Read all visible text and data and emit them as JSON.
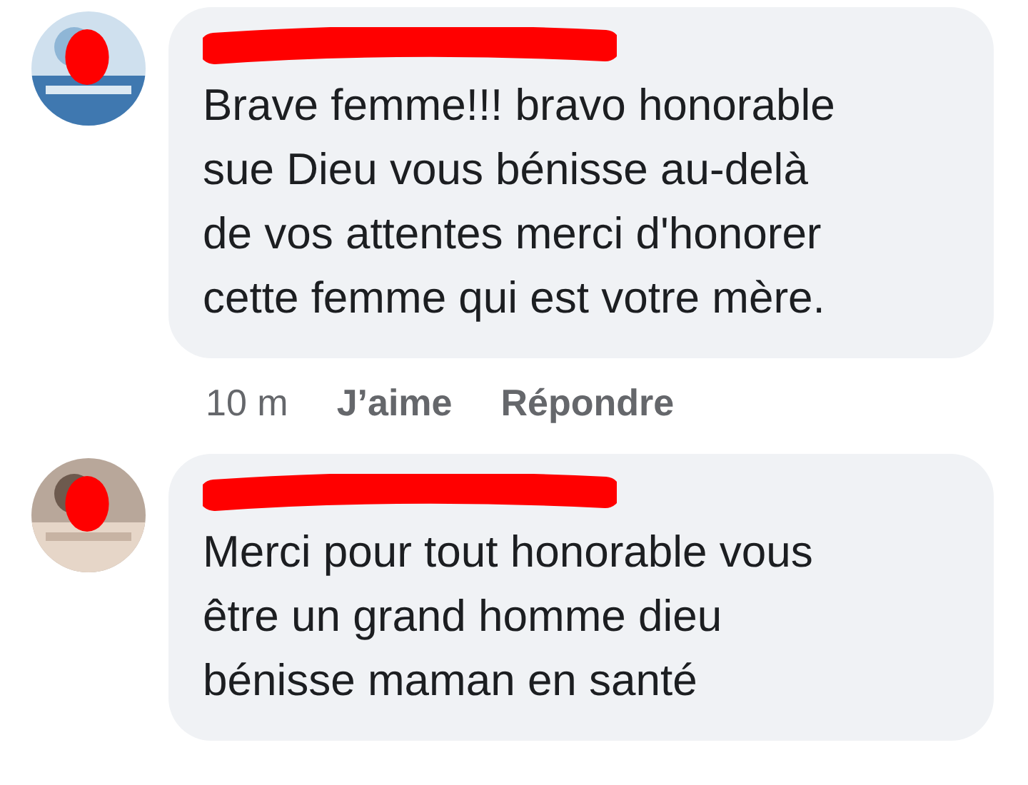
{
  "comments": [
    {
      "text": "Brave femme!!! bravo honorable\nsue Dieu vous bénisse au-delà\nde vos attentes merci d'honorer\ncette femme qui est votre mère.",
      "meta": {
        "time": "10 m",
        "like": "J’aime",
        "reply": "Répondre"
      }
    },
    {
      "text": "Merci pour tout honorable vous\nêtre un grand homme dieu\nbénisse maman en santé"
    }
  ]
}
